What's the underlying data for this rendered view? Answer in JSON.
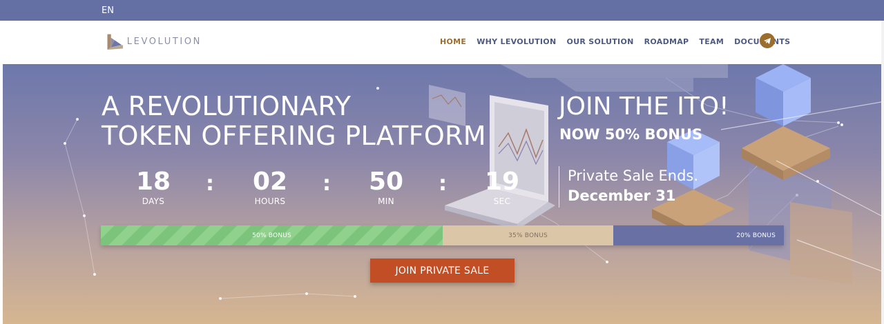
{
  "topbar": {
    "language": "EN"
  },
  "brand": {
    "name": "LEVOLUTION",
    "logo_icon": "levolution-logo-icon"
  },
  "nav": {
    "items": [
      {
        "label": "HOME",
        "active": true
      },
      {
        "label": "WHY LEVOLUTION",
        "active": false
      },
      {
        "label": "OUR SOLUTION",
        "active": false
      },
      {
        "label": "ROADMAP",
        "active": false
      },
      {
        "label": "TEAM",
        "active": false
      },
      {
        "label": "DOCUMENTS",
        "active": false
      }
    ],
    "telegram_icon": "telegram-icon"
  },
  "hero": {
    "headline_line1": "A REVOLUTIONARY",
    "headline_line2": "TOKEN OFFERING PLATFORM",
    "countdown": {
      "days": {
        "value": "18",
        "label": "DAYS"
      },
      "hours": {
        "value": "02",
        "label": "HOURS"
      },
      "minutes": {
        "value": "50",
        "label": "MIN"
      },
      "seconds": {
        "value": "19",
        "label": "SEC"
      },
      "separator": ":"
    },
    "ito_title": "JOIN THE ITO!",
    "ito_subtitle": "NOW 50% BONUS",
    "sale_ends_label": "Private Sale Ends.",
    "sale_ends_date": "December 31",
    "bonus_bar": [
      {
        "label": "50% BONUS",
        "fraction": 0.5,
        "color": "#8fd18d"
      },
      {
        "label": "35% BONUS",
        "fraction": 0.25,
        "color": "#dcc6a8"
      },
      {
        "label": "20% BONUS",
        "fraction": 0.25,
        "color": "#6870a4"
      }
    ],
    "cta_label": "JOIN PRIVATE SALE"
  },
  "colors": {
    "topbar": "#6470a3",
    "accent_gold": "#9b6e2e",
    "nav_text": "#4f5a82",
    "cta": "#c24e26"
  }
}
